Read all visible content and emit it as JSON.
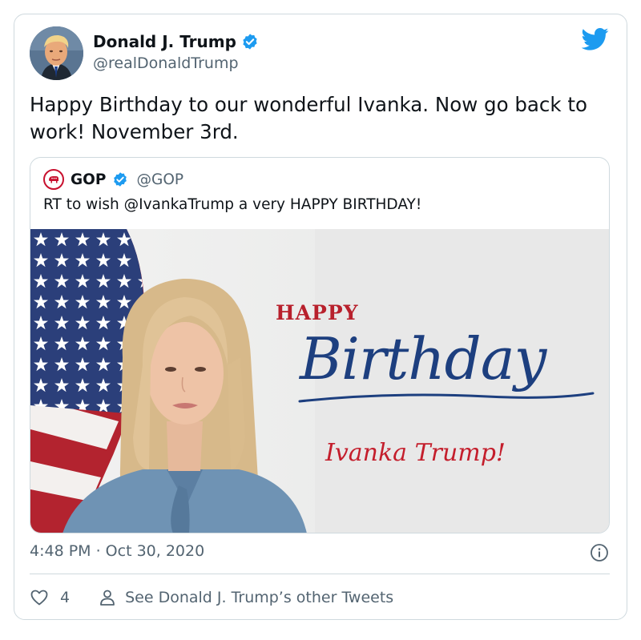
{
  "tweet": {
    "author_name": "Donald J. Trump",
    "author_handle": "@realDonaldTrump",
    "text": "Happy Birthday to our wonderful Ivanka. Now go back to work! November 3rd.",
    "timestamp": "4:48 PM · Oct 30, 2020",
    "likes": "4",
    "see_others": "See Donald J. Trump’s other Tweets"
  },
  "quote": {
    "author_name": "GOP",
    "author_handle": "@GOP",
    "text": "RT to wish @IvankaTrump a very HAPPY BIRTHDAY!",
    "image": {
      "line_happy": "HAPPY",
      "line_birthday": "Birthday",
      "line_name": "Ivanka Trump!"
    }
  },
  "icons": {
    "twitter": "twitter-bird-icon",
    "verified": "verified-badge-icon",
    "info": "info-icon",
    "like": "heart-icon",
    "person": "person-icon",
    "gop": "gop-elephant-icon"
  },
  "colors": {
    "twitter_blue": "#1d9bf0",
    "text_primary": "#0f1419",
    "text_secondary": "#536471",
    "border": "#cfd9de",
    "gop_red": "#c8102e",
    "birthday_blue": "#1d3f7f",
    "accent_red": "#c41e2c"
  }
}
